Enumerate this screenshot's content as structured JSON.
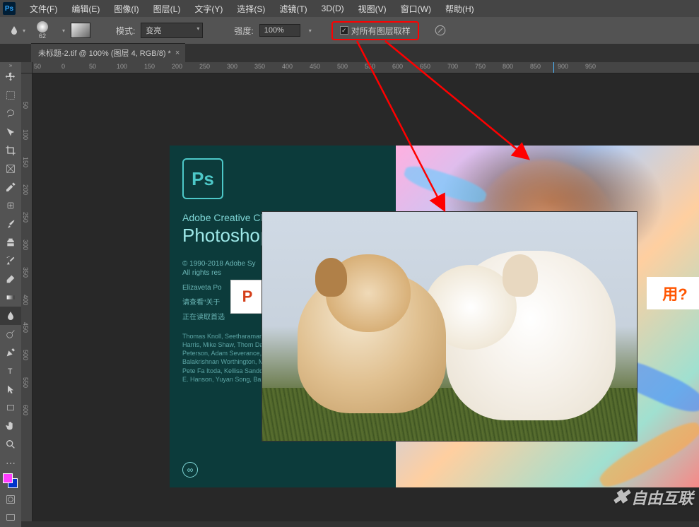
{
  "menu": {
    "items": [
      "文件(F)",
      "编辑(E)",
      "图像(I)",
      "图层(L)",
      "文字(Y)",
      "选择(S)",
      "滤镜(T)",
      "3D(D)",
      "视图(V)",
      "窗口(W)",
      "帮助(H)"
    ]
  },
  "options": {
    "brush_size": "62",
    "mode_label": "模式:",
    "mode_value": "变亮",
    "strength_label": "强度:",
    "strength_value": "100%",
    "sample_all_label": "对所有图层取样",
    "sample_all_checked": true
  },
  "tab": {
    "title": "未标题-2.tif @ 100% (图层 4, RGB/8) *"
  },
  "ruler_h": [
    "0",
    "50",
    "100",
    "150",
    "200",
    "250",
    "300",
    "350",
    "400",
    "450",
    "500",
    "550",
    "600",
    "650",
    "700",
    "750",
    "800",
    "850",
    "900"
  ],
  "ruler_h_neg": [
    "50",
    "0"
  ],
  "ruler_v": [
    "50",
    "100",
    "150",
    "200",
    "250",
    "300",
    "350",
    "400",
    "450",
    "500",
    "550",
    "600"
  ],
  "splash": {
    "line1": "Adobe Creative Cl",
    "line2": "Photoshop",
    "copyright1": "© 1990-2018 Adobe Sy",
    "copyright2": "All rights res",
    "artist": "Elizaveta Po",
    "about": "请查看“关于",
    "reading": "正在读取首选",
    "credits": "Thomas Knoll, Seetharaman N\nJackie Lincoln-Owyang, Alan E\nJerry Harris, Mike Shaw, Thom\nDavid Mohr, Yukie Takahashi,\nSnyder, John Peterson, Adam\nSeverance, Yuko Kagita, Foste\nTai Luxon, Vinod Balakrishnan\nWorthington, Mark Maguire, D\nWinston Hendrickson, Pete Fa\nItoda, Kellisa Sandoval, Steve\nSarah Stuckey, David Hackel,\nE. Hanson, Yuyan Song, Barkh\nRubbo, Jeff Sass, Stephen Ni"
  },
  "bg_text": "用?",
  "small_badge": "P",
  "watermark": "自由互联",
  "tools": [
    "move",
    "rect-marquee",
    "lasso",
    "quick-select",
    "crop",
    "frame",
    "eyedropper",
    "spot-heal",
    "brush",
    "clone",
    "history-brush",
    "eraser",
    "gradient",
    "blur",
    "dodge",
    "pen",
    "type",
    "path-select",
    "rectangle",
    "hand",
    "zoom"
  ]
}
